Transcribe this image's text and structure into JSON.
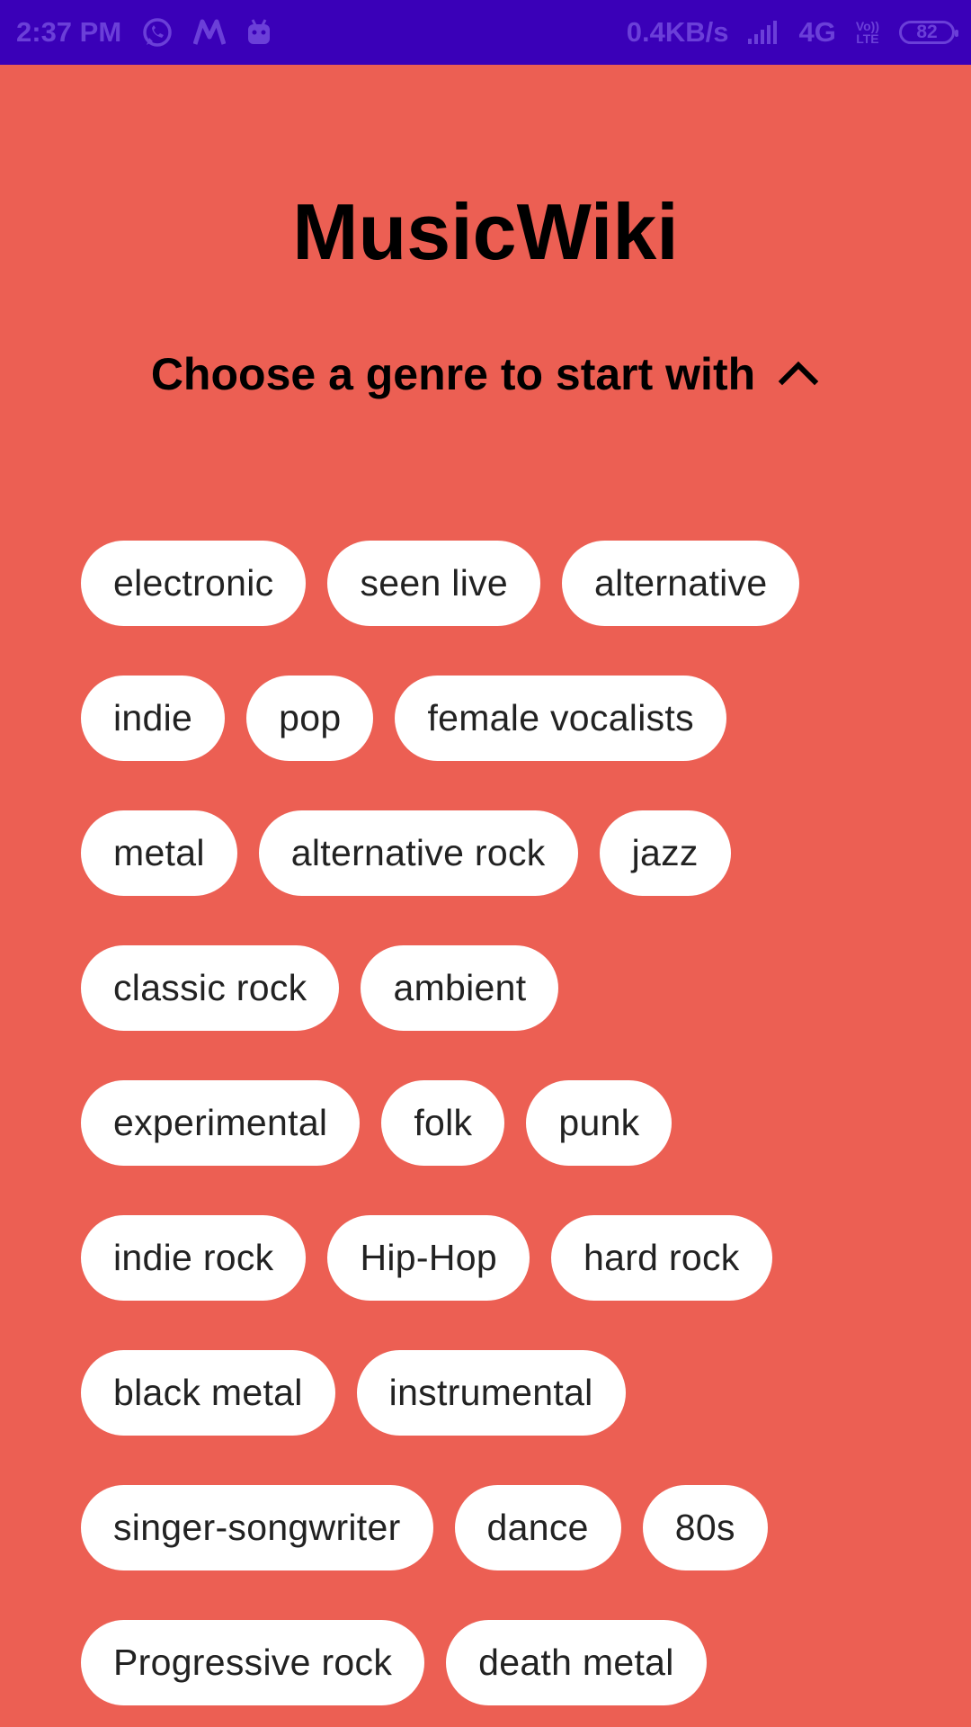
{
  "status_bar": {
    "time": "2:37 PM",
    "icons_left": [
      "whatsapp-icon",
      "myntra-icon",
      "android-icon"
    ],
    "speed": "0.4KB/s",
    "network": "4G",
    "volte_top": "Vo))",
    "volte_bottom": "LTE",
    "battery": "82",
    "bg_color": "#3a00b8"
  },
  "app": {
    "title": "MusicWiki",
    "subtitle": "Choose a genre to start with",
    "toggle_icon": "chevron-up-icon",
    "bg_color": "#ec5f53"
  },
  "genres": [
    [
      "electronic",
      "seen live",
      "alternative"
    ],
    [
      "indie",
      "pop",
      "female vocalists"
    ],
    [
      "metal",
      "alternative rock",
      "jazz"
    ],
    [
      "classic rock",
      "ambient"
    ],
    [
      "experimental",
      "folk",
      "punk"
    ],
    [
      "indie rock",
      "Hip-Hop",
      "hard rock"
    ],
    [
      "black metal",
      "instrumental"
    ],
    [
      "singer-songwriter",
      "dance",
      "80s"
    ],
    [
      "Progressive rock",
      "death metal"
    ]
  ]
}
